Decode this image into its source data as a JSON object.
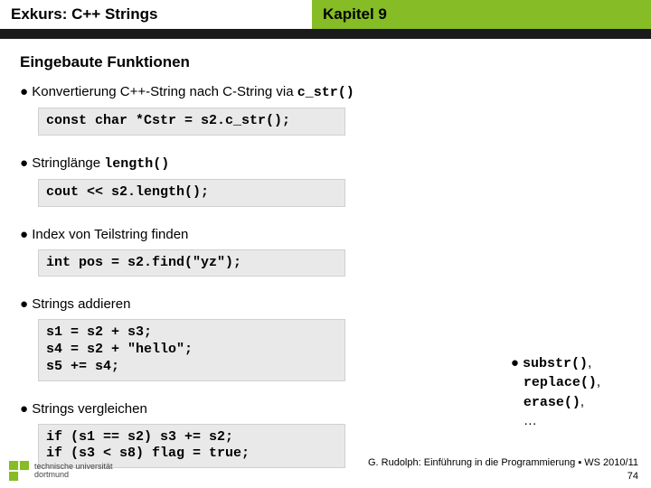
{
  "header": {
    "left": "Exkurs: C++ Strings",
    "right": "Kapitel 9"
  },
  "subtitle": "Eingebaute Funktionen",
  "bullets": [
    {
      "pre": "● Konvertierung C++-String nach C-String via ",
      "mono": "c_str()",
      "code": "const char *Cstr = s2.c_str();"
    },
    {
      "pre": "● Stringlänge ",
      "mono": "length()",
      "code": "cout << s2.length();"
    },
    {
      "pre": "● Index von Teilstring finden",
      "mono": "",
      "code": "int pos = s2.find(\"yz\");"
    },
    {
      "pre": "● Strings addieren",
      "mono": "",
      "code": "s1 = s2 + s3;\ns4 = s2 + \"hello\";\ns5 += s4;"
    },
    {
      "pre": "● Strings vergleichen",
      "mono": "",
      "code": "if (s1 == s2) s3 += s2;\nif (s3 < s8) flag = true;"
    }
  ],
  "sidefns": {
    "l1_pre": "● ",
    "l1_mono": "substr()",
    "l1_post": ",",
    "l2_mono": "replace()",
    "l2_post": ",",
    "l3_mono": "erase()",
    "l3_post": ",",
    "l4": "…"
  },
  "logo": {
    "line1": "technische universität",
    "line2": "dortmund"
  },
  "footer": {
    "line1": "G. Rudolph: Einführung in die Programmierung ▪ WS 2010/11",
    "line2": "74"
  }
}
